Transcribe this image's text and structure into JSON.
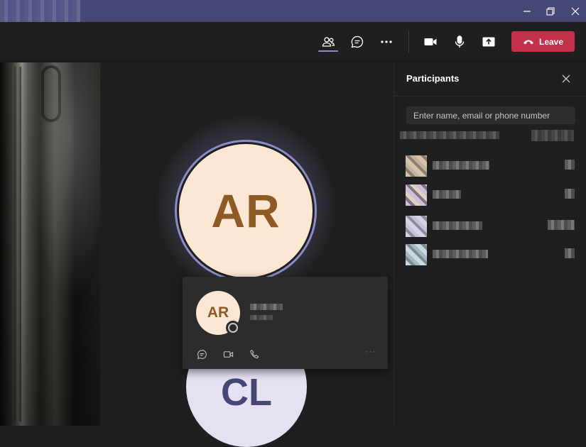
{
  "toolbar": {
    "leave_label": "Leave"
  },
  "stage": {
    "speaker_initials": "AR",
    "second_initials": "CL"
  },
  "profile_card": {
    "initials": "AR"
  },
  "panel": {
    "title": "Participants",
    "search_placeholder": "Enter name, email or phone number"
  },
  "colors": {
    "titlebar": "#464775",
    "accent": "#8b8cc7",
    "leave": "#c4314b",
    "avatar_bg": "#fbe7d4",
    "avatar_text": "#8e5a26"
  }
}
